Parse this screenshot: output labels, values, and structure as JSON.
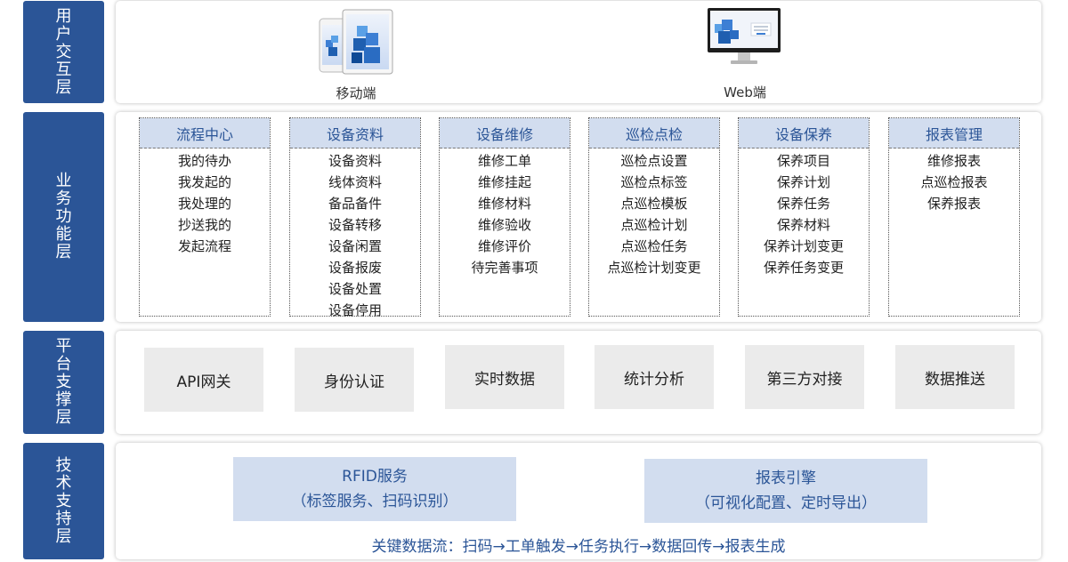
{
  "layers": {
    "user": "用户交互层",
    "business": "业务功能层",
    "platform": "平台支撑层",
    "tech": "技术支持层"
  },
  "devices": {
    "mobile_label": "移动端",
    "web_label": "Web端"
  },
  "modules": [
    {
      "title": "流程中心",
      "items": [
        "我的待办",
        "我发起的",
        "我处理的",
        "抄送我的",
        "发起流程"
      ]
    },
    {
      "title": "设备资料",
      "items": [
        "设备资料",
        "线体资料",
        "备品备件",
        "设备转移",
        "设备闲置",
        "设备报废",
        "设备处置",
        "设备停用"
      ]
    },
    {
      "title": "设备维修",
      "items": [
        "维修工单",
        "维修挂起",
        "维修材料",
        "维修验收",
        "维修评价",
        "待完善事项"
      ]
    },
    {
      "title": "巡检点检",
      "items": [
        "巡检点设置",
        "巡检点标签",
        "点巡检模板",
        "点巡检计划",
        "点巡检任务",
        "点巡检计划变更"
      ]
    },
    {
      "title": "设备保养",
      "items": [
        "保养项目",
        "保养计划",
        "保养任务",
        "保养材料",
        "保养计划变更",
        "保养任务变更"
      ]
    },
    {
      "title": "报表管理",
      "items": [
        "维修报表",
        "点巡检报表",
        "保养报表"
      ]
    }
  ],
  "platform": [
    "API网关",
    "身份认证",
    "实时数据",
    "统计分析",
    "第三方对接",
    "数据推送"
  ],
  "tech": {
    "boxes": [
      {
        "title": "RFID服务",
        "sub": "（标签服务、扫码识别）"
      },
      {
        "title": "报表引擎",
        "sub": "（可视化配置、定时导出）"
      }
    ],
    "flow": "关键数据流：扫码→工单触发→任务执行→数据回传→报表生成"
  },
  "colors": {
    "label_bg": "#2b5597",
    "module_header": "#d2ddef",
    "platform_box": "#ebebeb",
    "accent_text": "#2b5597"
  }
}
